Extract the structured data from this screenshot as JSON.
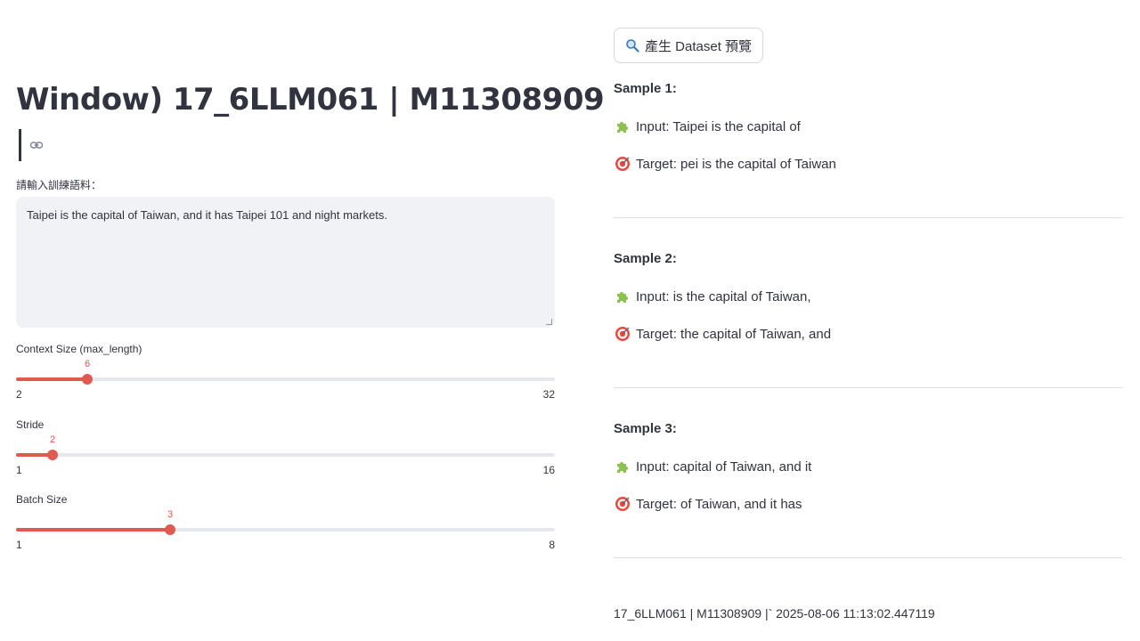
{
  "header": {
    "title": "Window) 17_6LLM061 | M11308909"
  },
  "input": {
    "label": "請輸入訓練語料：",
    "value": "Taipei is the capital of Taiwan, and it has Taipei 101 and night markets."
  },
  "sliders": [
    {
      "label": "Context Size (max_length)",
      "value": "6",
      "min": "1",
      "max": "32",
      "min_label": "2",
      "fraction": 0.133
    },
    {
      "label": "Stride",
      "value": "2",
      "min_label": "1",
      "max_label": "16",
      "fraction": 0.067
    },
    {
      "label": "Batch Size",
      "value": "3",
      "min_label": "1",
      "max_label": "8",
      "fraction": 0.286
    }
  ],
  "button": {
    "label": "產生 Dataset 預覽",
    "icon": "magnifier-icon"
  },
  "samples": [
    {
      "title": "Sample 1:",
      "input": "Input: Taipei is the capital of",
      "target": "Target: pei is the capital of Taiwan"
    },
    {
      "title": "Sample 2:",
      "input": "Input: is the capital of Taiwan,",
      "target": "Target: the capital of Taiwan, and"
    },
    {
      "title": "Sample 3:",
      "input": "Input: capital of Taiwan, and it",
      "target": "Target: of Taiwan, and it has"
    }
  ],
  "footer": {
    "text": "17_6LLM061 | M11308909 |` 2025-08-06 11:13:02.447119"
  },
  "colors": {
    "accent": "#e05a50",
    "textarea_bg": "#f0f2f6",
    "text": "#31333f"
  }
}
